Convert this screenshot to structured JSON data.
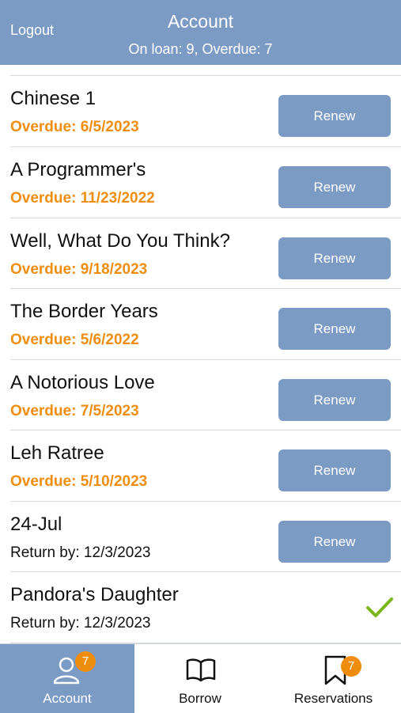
{
  "header": {
    "logout_label": "Logout",
    "title": "Account",
    "subtitle": "On loan: 9, Overdue: 7"
  },
  "loans": [
    {
      "title": "Chinese 1",
      "status": "Overdue: 6/5/2023",
      "overdue": true,
      "action": "Renew"
    },
    {
      "title": "A Programmer's",
      "status": "Overdue: 11/23/2022",
      "overdue": true,
      "action": "Renew"
    },
    {
      "title": "Well, What Do You Think?",
      "status": "Overdue: 9/18/2023",
      "overdue": true,
      "action": "Renew"
    },
    {
      "title": "The Border Years",
      "status": "Overdue: 5/6/2022",
      "overdue": true,
      "action": "Renew"
    },
    {
      "title": "A Notorious Love",
      "status": "Overdue: 7/5/2023",
      "overdue": true,
      "action": "Renew"
    },
    {
      "title": "Leh Ratree",
      "status": "Overdue: 5/10/2023",
      "overdue": true,
      "action": "Renew"
    },
    {
      "title": "24-Jul",
      "status": "Return by: 12/3/2023",
      "overdue": false,
      "action": "Renew"
    },
    {
      "title": "Pandora's Daughter",
      "status": "Return by: 12/3/2023",
      "overdue": false,
      "action": "renewed-check-icon"
    }
  ],
  "tabbar": {
    "tabs": [
      {
        "label": "Account",
        "icon": "person-icon",
        "badge": "7",
        "active": true
      },
      {
        "label": "Borrow",
        "icon": "open-book-icon",
        "badge": "",
        "active": false
      },
      {
        "label": "Reservations",
        "icon": "bookmark-icon",
        "badge": "7",
        "active": false
      }
    ]
  },
  "colors": {
    "accent": "#7b9bc5",
    "overdue": "#ef8d0e",
    "check": "#7cb518",
    "badge": "#ef8d0e"
  }
}
